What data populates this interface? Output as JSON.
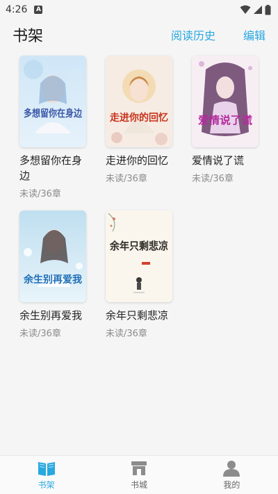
{
  "status": {
    "time": "4:26",
    "notification": "A"
  },
  "header": {
    "title": "书架",
    "history_label": "阅读历史",
    "edit_label": "编辑"
  },
  "books": [
    {
      "title": "多想留你在身边",
      "progress": "未读/36章",
      "cover_text": "多想留你在身边"
    },
    {
      "title": "走进你的回忆",
      "progress": "未读/36章",
      "cover_text": "走进你的回忆"
    },
    {
      "title": "爱情说了谎",
      "progress": "未读/36章",
      "cover_text": "爱情说了谎"
    },
    {
      "title": "余生别再爱我",
      "progress": "未读/36章",
      "cover_text": "余生别再爱我"
    },
    {
      "title": "余年只剩悲凉",
      "progress": "未读/36章",
      "cover_text": "余年只剩悲凉"
    }
  ],
  "nav": {
    "shelf_label": "书架",
    "shelf_icon": "book-icon",
    "store_label": "书城",
    "store_icon": "store-icon",
    "mine_label": "我的",
    "mine_icon": "person-icon"
  },
  "colors": {
    "accent": "#29a8e0",
    "inactive": "#8c8c8c"
  }
}
